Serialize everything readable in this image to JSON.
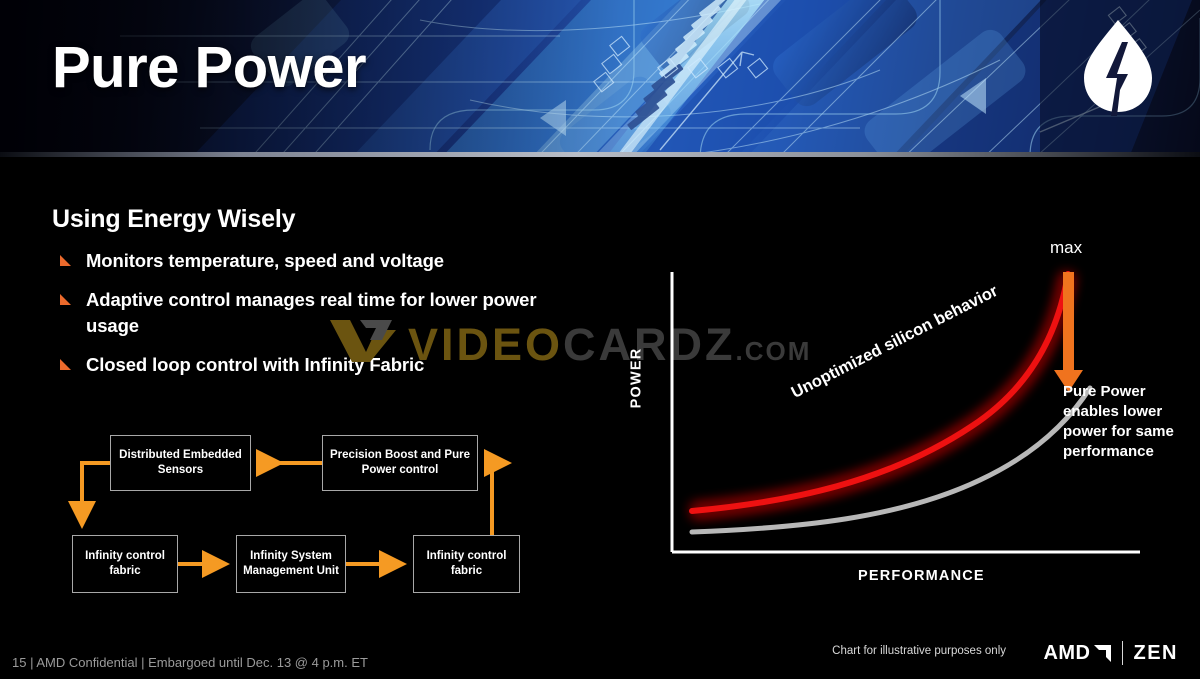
{
  "header": {
    "title": "Pure Power",
    "logo_icon": "leaf-lightning-icon"
  },
  "content": {
    "section_heading": "Using Energy Wisely",
    "bullets": [
      "Monitors temperature, speed and voltage",
      "Adaptive control manages real time for lower power usage",
      "Closed loop control with Infinity Fabric"
    ]
  },
  "watermark": {
    "mark": "V",
    "part1": "VIDEO",
    "part2": "CARDZ",
    "part3": ".COM"
  },
  "diagram": {
    "boxes": [
      {
        "id": "sensors",
        "label": "Distributed Embedded Sensors"
      },
      {
        "id": "precision",
        "label": "Precision Boost and Pure Power control"
      },
      {
        "id": "fabric1",
        "label": "Infinity control fabric"
      },
      {
        "id": "ismu",
        "label": "Infinity System Management Unit"
      },
      {
        "id": "fabric2",
        "label": "Infinity control fabric"
      }
    ],
    "arrow_color": "#f59a23"
  },
  "chart_data": {
    "type": "line",
    "title": "",
    "xlabel": "PERFORMANCE",
    "ylabel": "POWER",
    "xlim": [
      0,
      100
    ],
    "ylim": [
      0,
      100
    ],
    "grid": false,
    "legend": "none",
    "annotations": [
      {
        "name": "max-marker",
        "text": "max"
      },
      {
        "name": "unoptimized-curve-label",
        "text": "Unoptimized silicon behavior"
      },
      {
        "name": "pure-power-callout",
        "text": "Pure Power enables lower power for same performance"
      },
      {
        "name": "improvement-arrow",
        "text": "",
        "color": "#f0731e"
      }
    ],
    "series": [
      {
        "name": "Unoptimized silicon behavior",
        "color": "#ee1111",
        "x": [
          5,
          15,
          25,
          35,
          45,
          55,
          65,
          75,
          82,
          88,
          92,
          95
        ],
        "y": [
          20,
          21,
          23,
          26,
          30,
          36,
          45,
          58,
          68,
          80,
          90,
          97
        ]
      },
      {
        "name": "Pure Power",
        "color": "#b8b8b8",
        "x": [
          5,
          15,
          25,
          35,
          45,
          55,
          65,
          75,
          82,
          88,
          92,
          95
        ],
        "y": [
          13,
          14,
          15,
          17,
          20,
          24,
          30,
          38,
          45,
          53,
          59,
          64
        ]
      }
    ]
  },
  "footer": {
    "left_text": "15 | AMD Confidential | Embargoed until Dec. 13 @ 4 p.m. ET",
    "chart_note": "Chart for illustrative purposes only",
    "amd_label": "AMD",
    "zen_label": "ZEN"
  }
}
